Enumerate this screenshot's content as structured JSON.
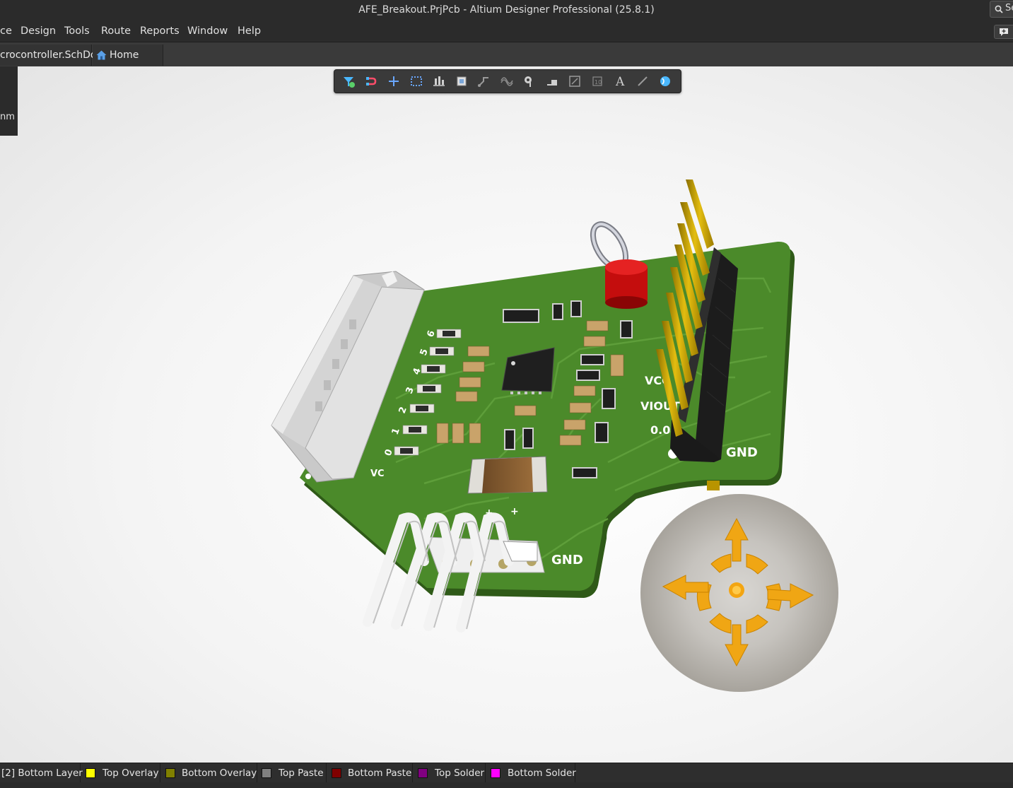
{
  "window": {
    "title": "AFE_Breakout.PrjPcb - Altium Designer Professional (25.8.1)",
    "search_label": "Se"
  },
  "menu": {
    "items": [
      "ce",
      "Design",
      "Tools",
      "Route",
      "Reports",
      "Window",
      "Help"
    ]
  },
  "tabs": {
    "schdoc": "crocontroller.SchDoc",
    "home": "Home Page"
  },
  "side_panel": {
    "unit_text": "nm"
  },
  "active_bar": {
    "tools": [
      "filter-icon",
      "interactive-routing-icon",
      "place-icon",
      "select-rectangle-icon",
      "align-icon",
      "component-icon",
      "route-icon",
      "diff-pair-icon",
      "via-icon",
      "polygon-icon",
      "dimension-icon",
      "keepout-icon",
      "text-icon",
      "line-icon",
      "3d-body-icon"
    ]
  },
  "pcb": {
    "silkscreen": {
      "gnd_right": "GND",
      "gnd_bottom": "GND",
      "vcc": "VCC",
      "viout": "VIOUT",
      "zero": "0.0",
      "vc": "VC",
      "pin_numbers": [
        "6",
        "5",
        "4",
        "3",
        "2",
        "1",
        "0"
      ],
      "bottom_pins": [
        "+",
        "-",
        "+"
      ]
    },
    "colors": {
      "board": "#4b8a2a",
      "header_pins": "#c9a400",
      "test_point": "#cc1111",
      "connector": "#d8d8d8",
      "navigator_arrows": "#f2a814"
    }
  },
  "layers": [
    {
      "label": "[2] Bottom Layer",
      "color": null
    },
    {
      "label": "Top Overlay",
      "color": "#ffff00"
    },
    {
      "label": "Bottom Overlay",
      "color": "#808000"
    },
    {
      "label": "Top Paste",
      "color": "#808080"
    },
    {
      "label": "Bottom Paste",
      "color": "#800000"
    },
    {
      "label": "Top Solder",
      "color": "#800080"
    },
    {
      "label": "Bottom Solder",
      "color": "#ff00ff"
    }
  ]
}
